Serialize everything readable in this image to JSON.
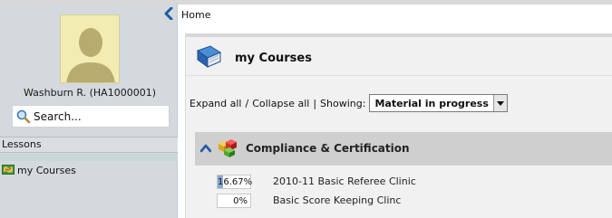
{
  "sidebar": {
    "user_name": "Washburn R. (HA1000001)",
    "search_label": "Search...",
    "lessons_heading": "Lessons",
    "lessons_items": [
      {
        "label": "my Courses",
        "icon": "map-icon"
      }
    ]
  },
  "breadcrumb": {
    "home_label": "Home"
  },
  "panel": {
    "title": "my Courses",
    "expand_label": "Expand all",
    "collapse_label": "Collapse all",
    "showing_label": "Showing:",
    "filter_value": "Material in progress"
  },
  "section": {
    "title": "Compliance & Certification",
    "courses": [
      {
        "progress_label": "16.67%",
        "progress": 16.67,
        "name": "2010-11 Basic Referee Clinic"
      },
      {
        "progress_label": "0%",
        "progress": 0,
        "name": "Basic Score Keeping Clinc"
      }
    ]
  },
  "colors": {
    "sidebar_bg": "#d4d9dd",
    "panel_bg": "#f1f1f1",
    "section_bar": "#cfcfcf",
    "accent_blue": "#1f5ca8",
    "progress_fill": "#8aa6d6"
  }
}
